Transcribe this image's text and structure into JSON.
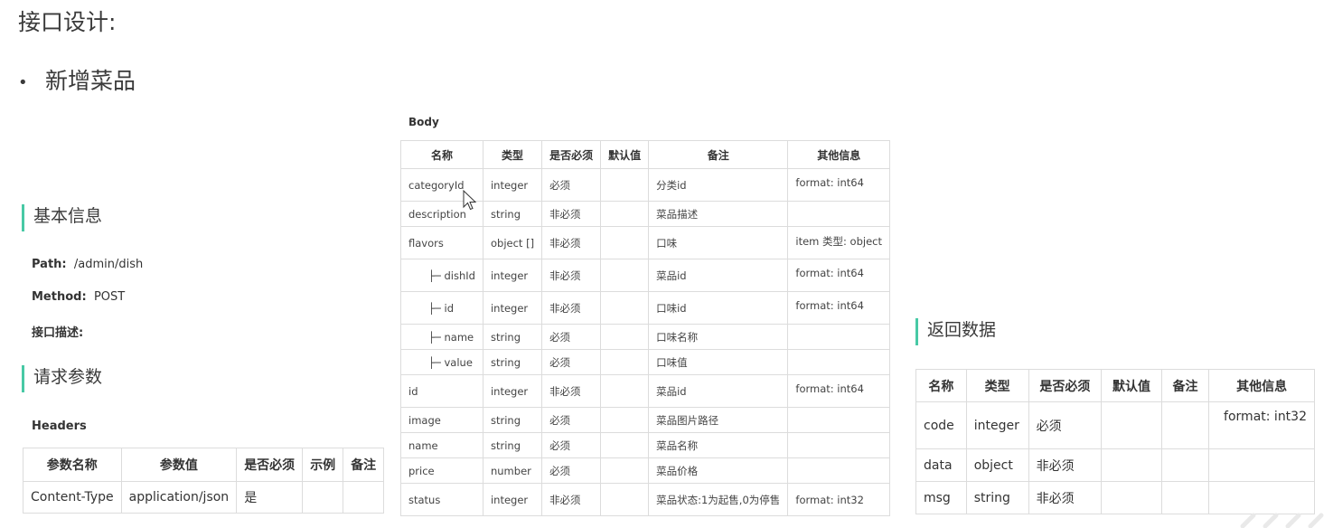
{
  "page": {
    "title": "接口设计:",
    "bullet": "新增菜品"
  },
  "basic_info": {
    "heading": "基本信息",
    "path_label": "Path:",
    "path_value": "/admin/dish",
    "method_label": "Method:",
    "method_value": "POST",
    "desc_label": "接口描述:"
  },
  "request": {
    "heading": "请求参数",
    "headers_label": "Headers",
    "headers_columns": [
      "参数名称",
      "参数值",
      "是否必须",
      "示例",
      "备注"
    ],
    "headers_rows": [
      [
        "Content-Type",
        "application/json",
        "是",
        "",
        ""
      ]
    ]
  },
  "body": {
    "label": "Body",
    "columns": [
      "名称",
      "类型",
      "是否必须",
      "默认值",
      "备注",
      "其他信息"
    ],
    "rows": [
      {
        "name": "categoryId",
        "type": "integer",
        "required": "必须",
        "default": "",
        "note": "分类id",
        "other": "format: int64"
      },
      {
        "name": "description",
        "type": "string",
        "required": "非必须",
        "default": "",
        "note": "菜品描述",
        "other": ""
      },
      {
        "name": "flavors",
        "type": "object []",
        "required": "非必须",
        "default": "",
        "note": "口味",
        "other": "item 类型: object"
      },
      {
        "name": "├─ dishId",
        "type": "integer",
        "required": "非必须",
        "default": "",
        "note": "菜品id",
        "other": "format: int64"
      },
      {
        "name": "├─ id",
        "type": "integer",
        "required": "非必须",
        "default": "",
        "note": "口味id",
        "other": "format: int64"
      },
      {
        "name": "├─ name",
        "type": "string",
        "required": "必须",
        "default": "",
        "note": "口味名称",
        "other": ""
      },
      {
        "name": "├─ value",
        "type": "string",
        "required": "必须",
        "default": "",
        "note": "口味值",
        "other": ""
      },
      {
        "name": "id",
        "type": "integer",
        "required": "非必须",
        "default": "",
        "note": "菜品id",
        "other": "format: int64"
      },
      {
        "name": "image",
        "type": "string",
        "required": "必须",
        "default": "",
        "note": "菜品图片路径",
        "other": ""
      },
      {
        "name": "name",
        "type": "string",
        "required": "必须",
        "default": "",
        "note": "菜品名称",
        "other": ""
      },
      {
        "name": "price",
        "type": "number",
        "required": "必须",
        "default": "",
        "note": "菜品价格",
        "other": ""
      },
      {
        "name": "status",
        "type": "integer",
        "required": "非必须",
        "default": "",
        "note": "菜品状态:1为起售,0为停售",
        "other": "format: int32"
      }
    ]
  },
  "response": {
    "heading": "返回数据",
    "columns": [
      "名称",
      "类型",
      "是否必须",
      "默认值",
      "备注",
      "其他信息"
    ],
    "rows": [
      {
        "name": "code",
        "type": "integer",
        "required": "必须",
        "default": "",
        "note": "",
        "other": "format: int32"
      },
      {
        "name": "data",
        "type": "object",
        "required": "非必须",
        "default": "",
        "note": "",
        "other": ""
      },
      {
        "name": "msg",
        "type": "string",
        "required": "非必须",
        "default": "",
        "note": "",
        "other": ""
      }
    ]
  },
  "colors": {
    "accent": "#48c9a5",
    "border": "#dcdcdc"
  }
}
